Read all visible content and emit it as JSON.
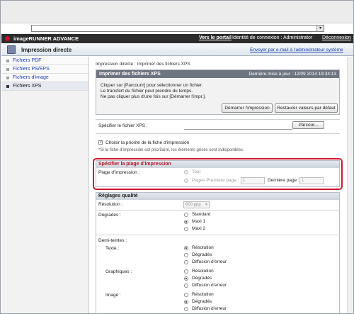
{
  "address_bar": {
    "dropdown_glyph": "▾"
  },
  "header": {
    "brand": "imageRUNNER ADVANCE",
    "portal_link": "Vers le portail",
    "login_text": "Identité de connexion : Administrator",
    "logout_link": "Déconnexion"
  },
  "subheader": {
    "title": "Impression directe",
    "mail_link": "Envoyer par e-mail à l'administrateur système"
  },
  "sidebar": {
    "items": [
      {
        "label": "Fichiers PDF"
      },
      {
        "label": "Fichiers PS/EPS"
      },
      {
        "label": "Fichiers d'image"
      },
      {
        "label": "Fichiers XPS"
      }
    ]
  },
  "breadcrumb": "Impression directe : Imprimer des fichiers XPS",
  "panel": {
    "title": "Imprimer des fichiers XPS",
    "updated": "Dernière mise à jour : 12/09 2014 19:34:13",
    "line1": "Cliquer sur [Parcourir] pour sélectionner un fichier.",
    "line2": "Le transfert du fichier peut prendre du temps.",
    "line3": "Ne pas cliquer plus d'une fois sur [Démarrer l'impr.].",
    "start_button": "Démarrer l'impression",
    "reset_button": "Restaurer valeurs par défaut"
  },
  "file": {
    "label": "Spécifier le fichier XPS :",
    "browse_button": "Parcour..."
  },
  "priority": {
    "checkbox_label": "Choisir la priorité de la fiche d'impression",
    "checked": true,
    "note": "*Si la fiche d'impression est prioritaire, les éléments grisés sont indisponibles."
  },
  "range_section": {
    "title": "Spécifier la plage d'impression",
    "label": "Plage d'impression :",
    "all": "Tout",
    "pages": "Pages Première page :",
    "first_value": "1",
    "last_label": "Dernière page :",
    "last_value": "1"
  },
  "quality_section": {
    "title": "Réglages qualité",
    "resolution_label": "Résolution :",
    "resolution_value": "600 ppp",
    "gradation_label": "Dégradés :",
    "gradation_options": [
      "Standard",
      "Maxi 1",
      "Maxi 2"
    ],
    "halftone_label": "Demi-teintes :",
    "text_label": "Texte :",
    "graphics_label": "Graphiques :",
    "image_label": "Image :",
    "halftone_options": [
      "Résolution",
      "Dégradés",
      "Diffusion d'erreur"
    ]
  }
}
